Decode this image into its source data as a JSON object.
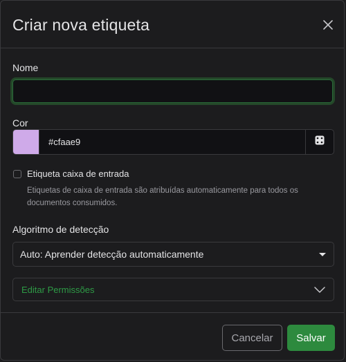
{
  "dialog": {
    "title": "Criar nova etiqueta"
  },
  "form": {
    "name": {
      "label": "Nome",
      "value": "",
      "placeholder": ""
    },
    "color": {
      "label": "Cor",
      "value": "#cfaae9",
      "swatch_color": "#cfaae9"
    },
    "inbox": {
      "label": "Etiqueta caixa de entrada",
      "checked": false,
      "help": "Etiquetas de caixa de entrada são atribuídas automaticamente para todos os documentos consumidos."
    },
    "algorithm": {
      "label": "Algoritmo de detecção",
      "selected": "Auto: Aprender detecção automaticamente"
    },
    "permissions": {
      "label": "Editar Permissões"
    }
  },
  "footer": {
    "cancel_label": "Cancelar",
    "save_label": "Salvar"
  },
  "colors": {
    "accent": "#2e9b46",
    "save_button": "#2d8a3e",
    "background": "#1c1c1e",
    "input_background": "#111114",
    "border": "#3a3a3d"
  },
  "icons": {
    "close": "close-icon",
    "random_color": "dice-icon",
    "select_caret": "caret-down-icon",
    "accordion": "chevron-down-icon"
  }
}
